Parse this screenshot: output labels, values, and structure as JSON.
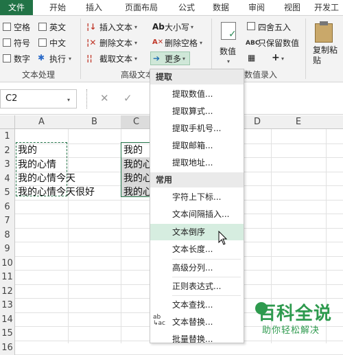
{
  "tabs": [
    "文件",
    "开始",
    "插入",
    "页面布局",
    "公式",
    "数据",
    "审阅",
    "视图",
    "开发工"
  ],
  "ribbon": {
    "checkboxes": [
      "空格",
      "英文",
      "符号",
      "中文",
      "数字",
      "执行"
    ],
    "text_group_label": "文本处理",
    "advanced_buttons": [
      "插入文本",
      "删除文本",
      "截取文本",
      "大小写",
      "删除空格",
      "更多"
    ],
    "advanced_group_label": "高级文本",
    "numeric_button": "数值",
    "round_button": "四舍五入",
    "keep_numeric_button": "只保留数值",
    "plus_label": "+",
    "numeric_group_label": "数值录入",
    "copy_paste_label": "复制粘贴"
  },
  "formula": {
    "namebox": "C2",
    "cancel": "✕",
    "confirm": "✓"
  },
  "grid": {
    "columns": [
      "A",
      "B",
      "C",
      "D",
      "E"
    ],
    "rows": [
      "1",
      "2",
      "3",
      "4",
      "5",
      "6",
      "7",
      "8",
      "9",
      "10",
      "11",
      "12",
      "13",
      "14",
      "15",
      "16"
    ],
    "colA": [
      "我的",
      "我的心情",
      "我的心情今天",
      "我的心情今天很好"
    ],
    "colC": [
      "我的",
      "我的心",
      "我的心",
      "我的心"
    ]
  },
  "menu": {
    "section1": "提取",
    "items1": [
      "提取数值...",
      "提取算式...",
      "提取手机号...",
      "提取邮箱...",
      "提取地址..."
    ],
    "section2": "常用",
    "items2": [
      "字符上下标...",
      "文本间隔插入...",
      "文本倒序",
      "文本长度...",
      "高级分列...",
      "正则表达式...",
      "文本查找...",
      "文本替换...",
      "批量替换..."
    ]
  },
  "watermark": {
    "title": "百科全说",
    "subtitle": "助你轻松解决"
  },
  "colors": {
    "accent": "#217346",
    "menu_highlight": "#d6ede0",
    "watermark": "#2e9a4e"
  }
}
